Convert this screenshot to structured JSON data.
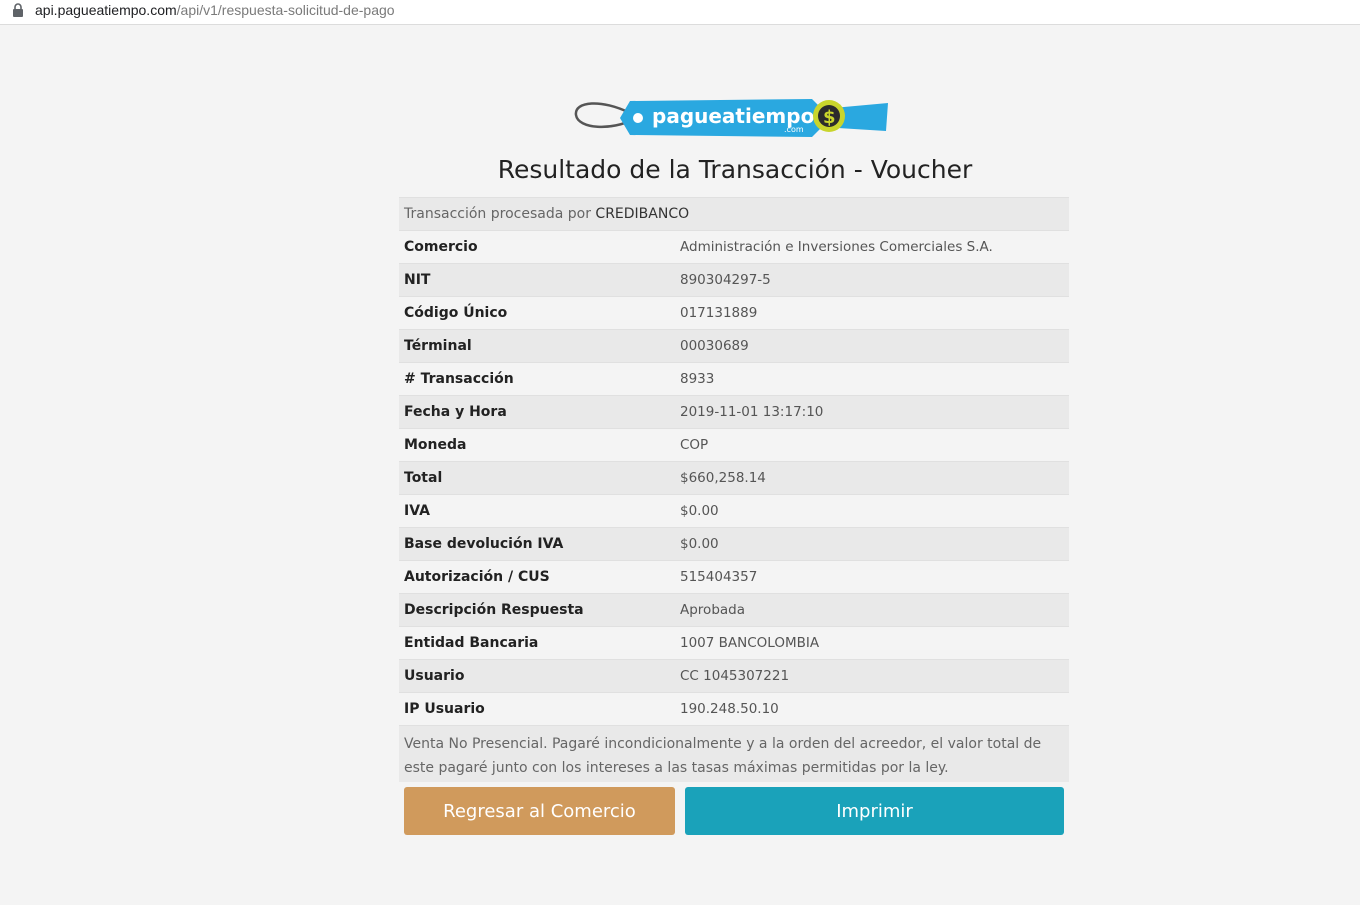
{
  "browser": {
    "url_host": "api.pagueatiempo.com",
    "url_path": "/api/v1/respuesta-solicitud-de-pago"
  },
  "logo": {
    "text": "pagueatiempo",
    "sub": ".com",
    "symbol": "$",
    "colors": {
      "tag": "#2aa8e0",
      "accent": "#c9d52c",
      "string": "#555555"
    }
  },
  "title": "Resultado de la Transacción - Voucher",
  "processed": {
    "prefix": "Transacción procesada por",
    "processor": "CREDIBANCO"
  },
  "rows": [
    {
      "label": "Comercio",
      "value": "Administración e Inversiones Comerciales S.A."
    },
    {
      "label": "NIT",
      "value": "890304297-5"
    },
    {
      "label": "Código Único",
      "value": "017131889"
    },
    {
      "label": "Términal",
      "value": "00030689"
    },
    {
      "label": "# Transacción",
      "value": "8933"
    },
    {
      "label": "Fecha y Hora",
      "value": "2019-11-01 13:17:10"
    },
    {
      "label": "Moneda",
      "value": "COP"
    },
    {
      "label": "Total",
      "value": "$660,258.14"
    },
    {
      "label": "IVA",
      "value": "$0.00"
    },
    {
      "label": "Base devolución IVA",
      "value": "$0.00"
    },
    {
      "label": "Autorización / CUS",
      "value": "515404357"
    },
    {
      "label": "Descripción Respuesta",
      "value": "Aprobada"
    },
    {
      "label": "Entidad Bancaria",
      "value": "1007 BANCOLOMBIA"
    },
    {
      "label": "Usuario",
      "value": "CC 1045307221"
    },
    {
      "label": "IP Usuario",
      "value": "190.248.50.10"
    }
  ],
  "note": "Venta No Presencial. Pagaré incondicionalmente y a la orden del acreedor, el valor total de este pagaré junto con los intereses a las tasas máximas permitidas por la ley.",
  "buttons": {
    "back": "Regresar al Comercio",
    "print": "Imprimir"
  },
  "colors": {
    "back_button": "#d09a5c",
    "print_button": "#1aa2ba"
  }
}
